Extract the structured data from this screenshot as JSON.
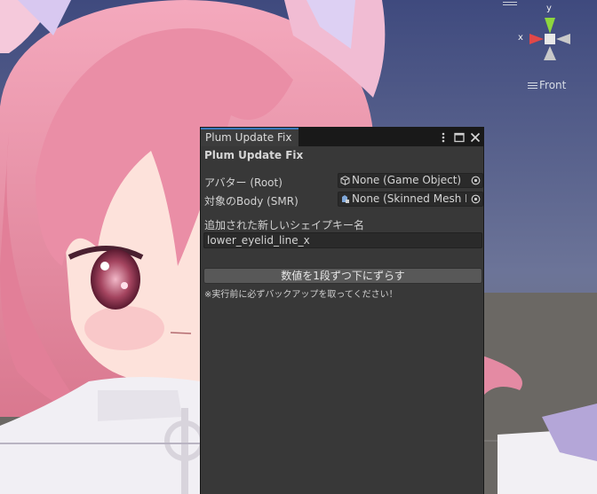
{
  "scene": {
    "view_label": "Front",
    "gizmo": {
      "y_axis": "y",
      "x_axis": "x"
    },
    "colors": {
      "sky": "#4f5b8a",
      "ground": "#6a6863",
      "hair": "#e98fa8",
      "skin": "#fde3dc",
      "eye": "#8a2c4a"
    }
  },
  "window": {
    "tab_title": "Plum Update Fix",
    "header": "Plum Update Fix",
    "avatar_label": "アバター (Root)",
    "avatar_value": "None (Game Object)",
    "body_label": "対象のBody (SMR)",
    "body_value": "None (Skinned Mesh R",
    "shape_key_label": "追加された新しいシェイプキー名",
    "shape_key_value": "lower_eyelid_line_x",
    "button_label": "数値を1段ずつ下にずらす",
    "warning": "※実行前に必ずバックアップを取ってください！",
    "icons": [
      "kebab-menu-icon",
      "maximize-icon",
      "close-icon"
    ],
    "accent": "#3a79bb"
  }
}
